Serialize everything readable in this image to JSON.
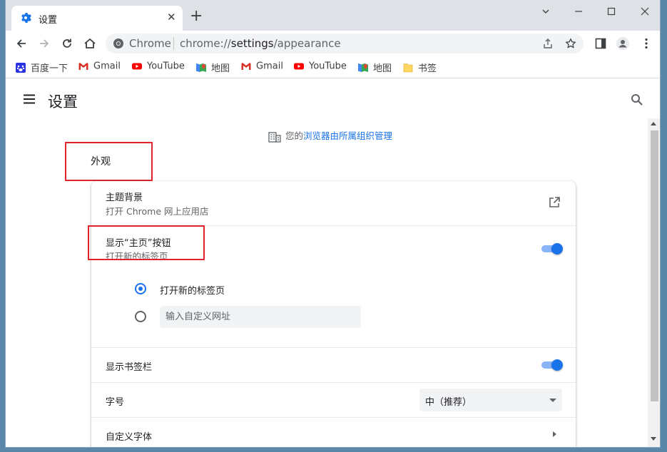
{
  "tab": {
    "title": "设置",
    "close_icon": "close-icon",
    "new_tab_label": "+"
  },
  "window_controls": {
    "dropdown": "⌄",
    "minimize": "—",
    "maximize": "☐",
    "close": "✕"
  },
  "omnibox": {
    "site_label": "Chrome",
    "url_prefix": "chrome://",
    "url_host": "settings",
    "url_path": "/appearance"
  },
  "bookmarks": [
    {
      "label": "百度一下",
      "icon": "baidu-icon"
    },
    {
      "label": "Gmail",
      "icon": "gmail-icon"
    },
    {
      "label": "YouTube",
      "icon": "youtube-icon"
    },
    {
      "label": "地图",
      "icon": "maps-icon"
    },
    {
      "label": "Gmail",
      "icon": "gmail-icon"
    },
    {
      "label": "YouTube",
      "icon": "youtube-icon"
    },
    {
      "label": "地图",
      "icon": "maps-icon"
    },
    {
      "label": "书签",
      "icon": "folder-icon"
    }
  ],
  "settings": {
    "title": "设置",
    "managed_prefix": "您的",
    "managed_link": "浏览器由所属组织管理",
    "section_title": "外观",
    "theme": {
      "title": "主题背景",
      "subtitle": "打开 Chrome 网上应用店"
    },
    "home_button": {
      "title": "显示“主页”按钮",
      "subtitle": "打开新的标签页",
      "enabled": true,
      "option_new_tab": "打开新的标签页",
      "custom_url_placeholder": "输入自定义网址",
      "selected_option": "new_tab"
    },
    "bookmarks_bar": {
      "title": "显示书签栏",
      "enabled": true
    },
    "font_size": {
      "title": "字号",
      "value": "中（推荐）"
    },
    "custom_fonts": {
      "title": "自定义字体"
    }
  },
  "colors": {
    "accent": "#1a73e8",
    "highlight_box": "#e0242b"
  }
}
